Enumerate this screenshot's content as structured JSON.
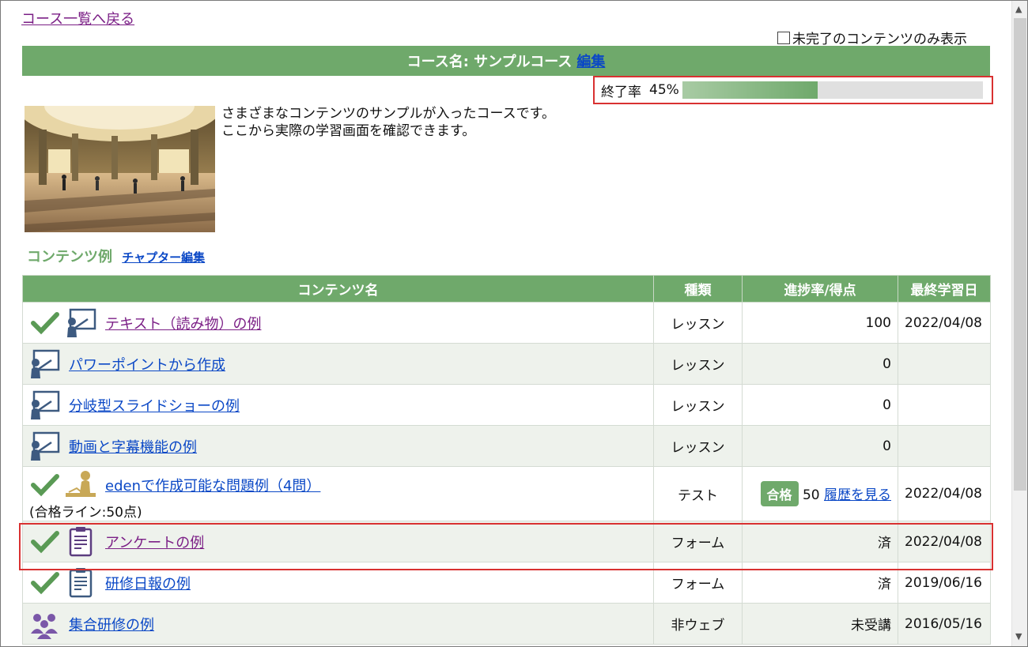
{
  "nav": {
    "back_link": "コース一覧へ戻る"
  },
  "filter": {
    "label": "未完了のコンテンツのみ表示"
  },
  "course": {
    "title": "コース名: サンプルコース",
    "edit_label": "編集",
    "description_line1": "さまざまなコンテンツのサンプルが入ったコースです。",
    "description_line2": "ここから実際の学習画面を確認できます。"
  },
  "progress": {
    "label": "終了率",
    "percent_text": "45%",
    "value": 0.45
  },
  "section": {
    "title": "コンテンツ例",
    "chapter_edit": "チャプター編集"
  },
  "table": {
    "headers": {
      "name": "コンテンツ名",
      "type": "種類",
      "progress": "進捗率/得点",
      "date": "最終学習日"
    },
    "rows": [
      {
        "name": "テキスト（読み物）の例",
        "type": "レッスン",
        "progress": "100",
        "date": "2022/04/08"
      },
      {
        "name": "パワーポイントから作成",
        "type": "レッスン",
        "progress": "0",
        "date": ""
      },
      {
        "name": "分岐型スライドショーの例",
        "type": "レッスン",
        "progress": "0",
        "date": ""
      },
      {
        "name": "動画と字幕機能の例",
        "type": "レッスン",
        "progress": "0",
        "date": ""
      },
      {
        "name": "edenで作成可能な問題例（4問）",
        "note": "(合格ライン:50点)",
        "type": "テスト",
        "badge": "合格",
        "score": "50",
        "history": "履歴を見る",
        "date": "2022/04/08"
      },
      {
        "name": "アンケートの例",
        "type": "フォーム",
        "progress": "済",
        "date": "2022/04/08"
      },
      {
        "name": "研修日報の例",
        "type": "フォーム",
        "progress": "済",
        "date": "2019/06/16"
      },
      {
        "name": "集合研修の例",
        "type": "非ウェブ",
        "progress": "未受講",
        "date": "2016/05/16"
      }
    ]
  },
  "colors": {
    "header_green": "#6fa96b",
    "link_blue": "#0b48c6",
    "visited_purple": "#7b1f86",
    "highlight_red": "#d93131"
  }
}
